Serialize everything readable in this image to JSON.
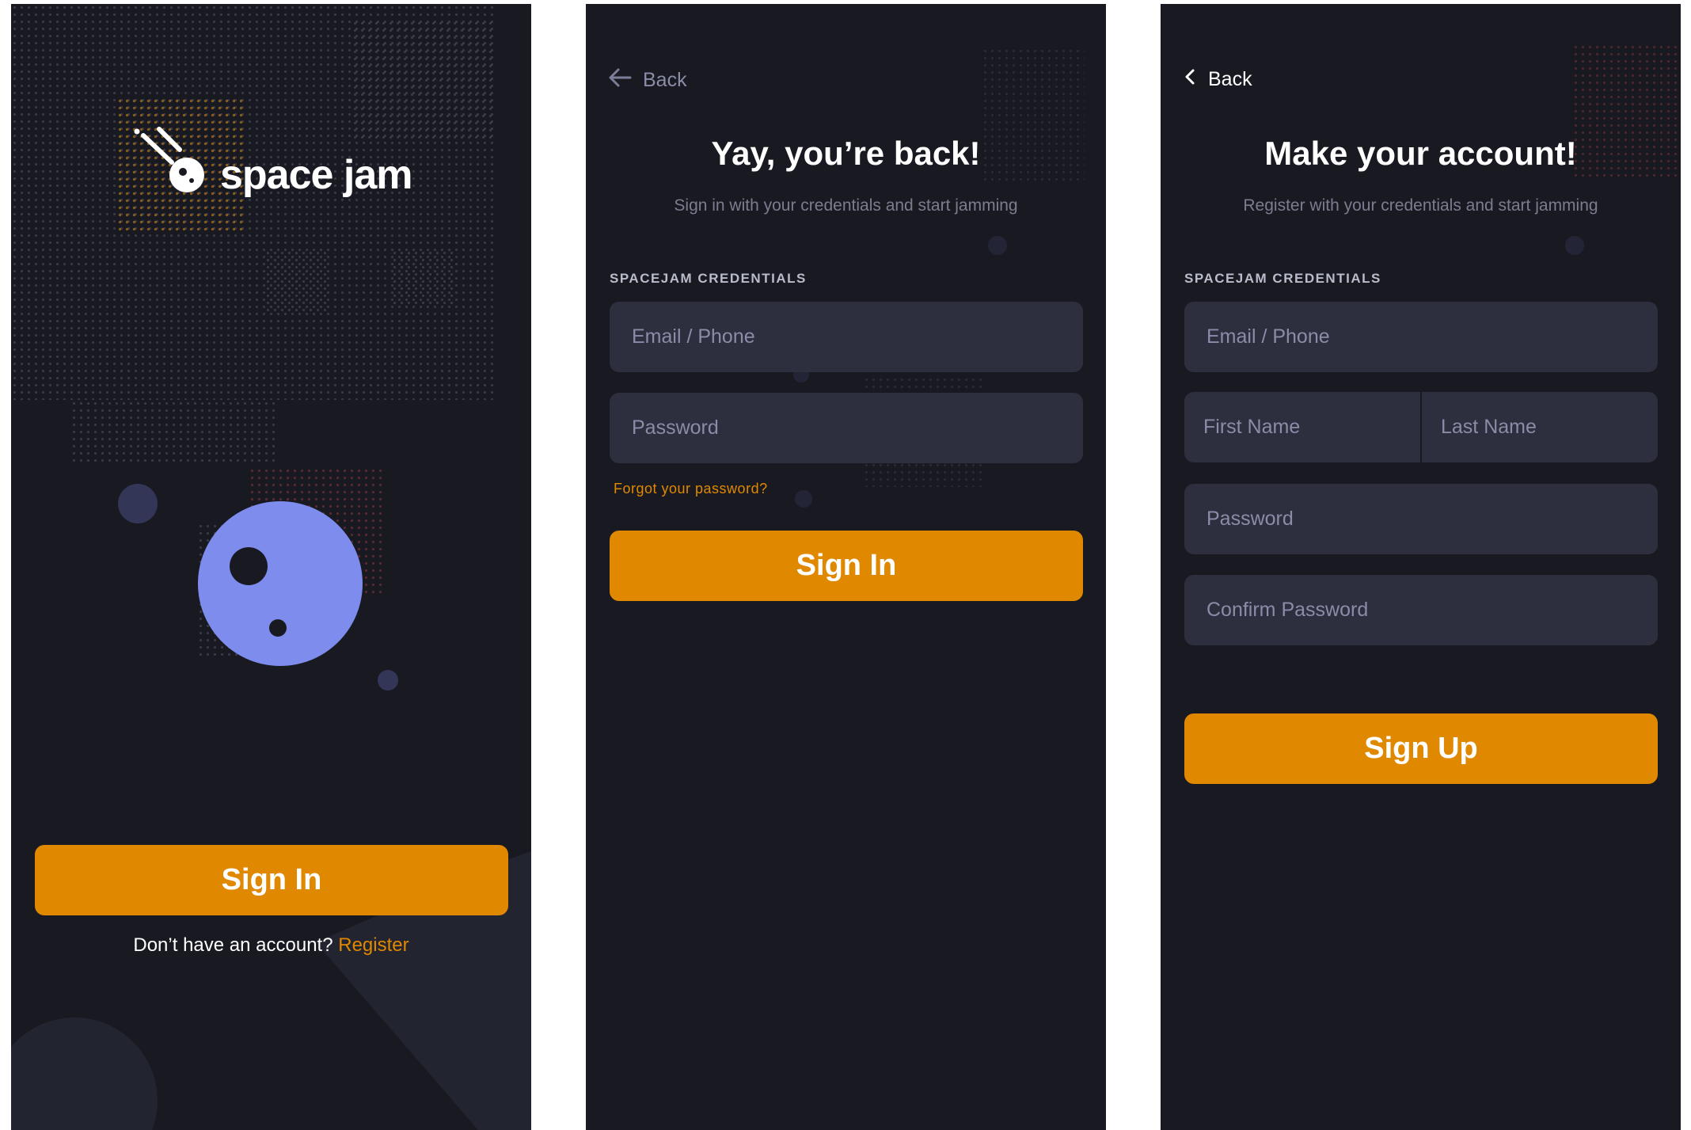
{
  "screen1": {
    "brand": "space jam",
    "sign_in_label": "Sign In",
    "register_prompt": "Don’t have an account?",
    "register_link": "Register"
  },
  "screen2": {
    "back_label": "Back",
    "title": "Yay, you’re back!",
    "subtitle": "Sign in with your credentials and start jamming",
    "section_label": "SPACEJAM CREDENTIALS",
    "email_placeholder": "Email / Phone",
    "password_placeholder": "Password",
    "forgot_label": "Forgot your password?",
    "sign_in_label": "Sign In"
  },
  "screen3": {
    "back_label": "Back",
    "title": "Make your account!",
    "subtitle": "Register with your credentials and start jamming",
    "section_label": "SPACEJAM CREDENTIALS",
    "email_placeholder": "Email / Phone",
    "first_name_placeholder": "First Name",
    "last_name_placeholder": "Last Name",
    "password_placeholder": "Password",
    "confirm_password_placeholder": "Confirm Password",
    "sign_up_label": "Sign Up"
  },
  "colors": {
    "background": "#191a21",
    "accent": "#e08800",
    "input_bg": "#2d2f3e",
    "planet": "#7e8ced",
    "placeholder": "#8a8ca8"
  },
  "icons": [
    "comet-logo-icon",
    "arrow-left-icon",
    "chevron-left-icon",
    "planet-illustration"
  ]
}
